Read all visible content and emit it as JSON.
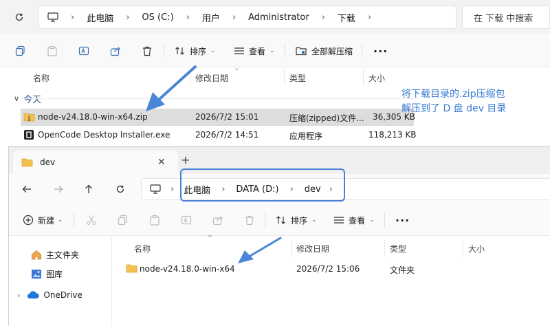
{
  "top": {
    "breadcrumb": [
      "此电脑",
      "OS (C:)",
      "用户",
      "Administrator",
      "下载"
    ],
    "search_placeholder": "在 下载 中搜索",
    "toolbar": {
      "sort": "排序",
      "view": "查看",
      "extract_all": "全部解压缩"
    },
    "columns": {
      "name": "名称",
      "date": "修改日期",
      "type": "类型",
      "size": "大小"
    },
    "group": "今天",
    "files": [
      {
        "name": "node-v24.18.0-win-x64.zip",
        "date": "2026/7/2 15:01",
        "type": "压缩(zipped)文件...",
        "size": "36,305 KB",
        "selected": true
      },
      {
        "name": "OpenCode Desktop Installer.exe",
        "date": "2026/7/2 14:51",
        "type": "应用程序",
        "size": "118,213 KB",
        "selected": false
      }
    ]
  },
  "annotation": {
    "line1": "将下载目录的.zip压缩包",
    "line2": "解压到了 D 盘 dev 目录"
  },
  "bottom": {
    "tab_title": "dev",
    "breadcrumb": [
      "此电脑",
      "DATA (D:)",
      "dev"
    ],
    "toolbar": {
      "new": "新建",
      "sort": "排序",
      "view": "查看"
    },
    "sidebar": [
      {
        "label": "主文件夹",
        "icon": "home-icon"
      },
      {
        "label": "图库",
        "icon": "gallery-icon"
      },
      {
        "label": "OneDrive",
        "icon": "cloud-icon"
      }
    ],
    "columns": {
      "name": "名称",
      "date": "修改日期",
      "type": "类型",
      "size": "大小"
    },
    "files": [
      {
        "name": "node-v24.18.0-win-x64",
        "date": "2026/7/2 15:06",
        "type": "文件夹",
        "size": ""
      }
    ]
  },
  "colors": {
    "accent": "#3a7bd5",
    "arrow": "#4a86d8",
    "selection": "#dddddd",
    "folder": "#f2c14e"
  }
}
